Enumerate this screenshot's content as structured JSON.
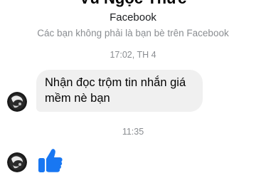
{
  "conversation": {
    "contact_name": "Vũ Ngọc Thức",
    "source": "Facebook",
    "relationship_note": "Các bạn không phải là bạn bè trên Facebook"
  },
  "messages": [
    {
      "timestamp": "17:02, TH 4",
      "text": "Nhận đọc trộm tin nhắn giá mềm nè bạn",
      "icon": "avatar-icon"
    },
    {
      "timestamp": "11:35",
      "icon": "thumbs-up-icon",
      "icon_color": "#1877f2"
    }
  ]
}
